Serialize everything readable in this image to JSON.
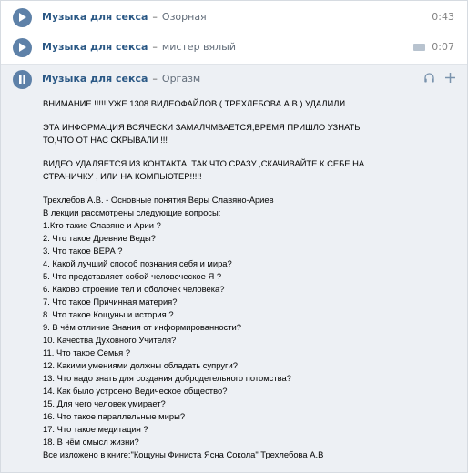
{
  "tracks": [
    {
      "artist": "Музыка для секса",
      "separator": "–",
      "title": "Озорная",
      "duration": "0:43",
      "playing": false
    },
    {
      "artist": "Музыка для секса",
      "separator": "–",
      "title": "мистер вялый",
      "duration": "0:07",
      "playing": false
    },
    {
      "artist": "Музыка для секса",
      "separator": "–",
      "title": "Оргазм",
      "duration": "",
      "playing": true
    }
  ],
  "lyrics": {
    "p1": "ВНИМАНИЕ !!!!! УЖЕ 1308 ВИДЕОФАЙЛОВ ( ТРЕХЛЕБОВА А.В ) УДАЛИЛИ.",
    "p2": [
      "ЭТА ИНФОРМАЦИЯ ВСЯЧЕСКИ ЗАМАЛЧМВАЕТСЯ,ВРЕМЯ ПРИШЛО УЗНАТЬ",
      "ТО,ЧТО ОТ НАС СКРЫВАЛИ !!!"
    ],
    "p3": [
      "ВИДЕО УДАЛЯЕТСЯ ИЗ КОНТАКТА, ТАК ЧТО СРАЗУ ,СКАЧИВАЙТЕ К СЕБЕ НА",
      "СТРАНИЧКУ , ИЛИ НА КОМПЬЮТЕР!!!!!"
    ],
    "lines": [
      "Трехлебов А.В. - Основные понятия Веры Славяно-Ариев",
      "В лекции рассмотрены следующие вопросы:",
      "1.Кто такие Славяне и Арии ?",
      "2. Что такое Древние Веды?",
      "3. Что такое ВЕРА ?",
      "4. Какой лучший способ познания себя и мира?",
      "5. Что представляет собой человеческое Я ?",
      "6. Каково строение тел и оболочек человека?",
      "7. Что такое Причинная материя?",
      "8. Что такое Кощуны и история ?",
      "9. В чём отличие Знания от информированности?",
      "10. Качества Духовного Учителя?",
      "11. Что такое Семья ?",
      "12. Какими умениями должны обладать супруги?",
      "13. Что надо знать для создания добродетельного потомства?",
      "14. Как было устроено Ведическое общество?",
      "15. Для чего человек умирает?",
      "16. Что такое параллельные миры?",
      "17. Что такое медитация ?",
      "18. В чём смысл жизни?",
      "Все изложено в книге:\"Кощуны Финиста Ясна Сокола\" Трехлебова А.В"
    ]
  },
  "colors": {
    "accent": "#5e81a8",
    "artist": "#2a5885",
    "panel": "#edf0f4"
  },
  "icons": {
    "play": "play-icon",
    "pause": "pause-icon",
    "hq": "hq-icon",
    "headset": "headphones-icon",
    "add": "plus-icon"
  }
}
